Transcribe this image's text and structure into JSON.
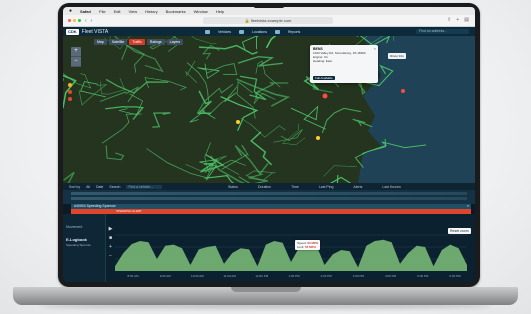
{
  "os_menubar": {
    "apple": "",
    "items": [
      "Safari",
      "File",
      "Edit",
      "View",
      "History",
      "Bookmarks",
      "Window",
      "Help"
    ]
  },
  "browser": {
    "url": "fleetvista.example.com",
    "dot_colors": [
      "#ff5f57",
      "#febc2e",
      "#28c840"
    ]
  },
  "app": {
    "logo": "CDK",
    "name": "Fleet VISTA",
    "nav_labels": [
      "Vehicles",
      "Locations",
      "Reports"
    ],
    "search_placeholder": "Find an address..."
  },
  "map": {
    "toolbar": [
      "Map",
      "Satellite",
      "Traffic",
      "Ratings",
      "Layers"
    ],
    "active_tool": "Traffic",
    "popup": {
      "title": "BENS",
      "lines": [
        "1000 Valley Rd, Stroudsburg, PA 18360",
        "Engine: On",
        "Heading: East"
      ],
      "button": "Fall Available",
      "close": "×"
    },
    "callout": "Driver Info",
    "colors": {
      "land": "#24341f",
      "road": "#4fc46a",
      "water": "#1f4256"
    }
  },
  "table": {
    "toolbar": [
      "Sort by",
      "All",
      "Date",
      "Search"
    ],
    "search_placeholder": "Find a vehicle...",
    "columns": [
      "Status",
      "Duration",
      "Time",
      "Last Ping",
      "Alerts",
      "Last Known"
    ],
    "selected_row": {
      "id": "#40004",
      "label": "Speeding Sparrow",
      "close": "×"
    },
    "alert_row": "SPEEDING ALERT"
  },
  "lower": {
    "section_title": "Movement",
    "vehicle": "E-Logbook",
    "vehicle_sub": "Speeding Sparrow",
    "controls": [
      "▶",
      "■",
      "+",
      "−"
    ],
    "reset_button": "Reset zoom",
    "tooltip": {
      "speed_label": "Speed:",
      "speed_value": "60 MPH",
      "limit_label": "Limit:",
      "limit_value": "55 MPH"
    }
  },
  "chart_data": {
    "type": "area",
    "title": "",
    "xlabel": "",
    "ylabel": "",
    "x": [
      "8:00 AM",
      "9:00 AM",
      "10:00 AM",
      "11:00 AM",
      "12:00 PM",
      "1:00 PM",
      "2:00 PM",
      "3:00 PM",
      "4:00 PM",
      "5:00 PM",
      "6:00 PM"
    ],
    "series": [
      {
        "values": [
          8,
          30,
          45,
          50,
          48,
          20,
          42,
          44,
          38,
          10,
          36,
          40,
          42,
          12,
          30,
          38,
          36,
          8,
          44,
          50,
          47,
          15,
          40,
          48,
          44,
          10,
          28,
          35,
          33,
          6,
          42,
          50,
          52,
          48,
          12,
          30,
          42,
          40,
          8,
          35,
          44,
          38,
          10
        ]
      }
    ],
    "ylim": [
      0,
      80
    ],
    "fill_color": "#7fc07a"
  }
}
